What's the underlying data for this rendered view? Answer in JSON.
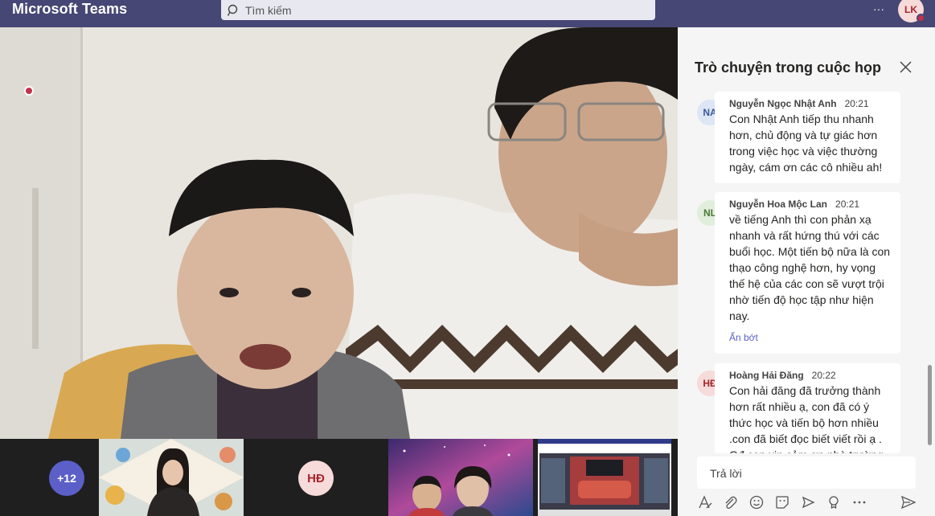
{
  "app": {
    "title": "Microsoft Teams",
    "search_placeholder": "Tìm kiếm",
    "user_initials": "LK",
    "more_label": "···"
  },
  "strip": {
    "overflow_count": "+12",
    "tile_hd_initials": "HĐ"
  },
  "chat": {
    "title": "Trò chuyện trong cuộc họp",
    "messages": [
      {
        "initials": "NA",
        "name": "Nguyễn Ngọc Nhật Anh",
        "time": "20:21",
        "text": "Con Nhật Anh tiếp thu nhanh hơn, chủ động và tự giác hơn trong việc học và việc thường ngày, cám ơn các cô nhiều ah!",
        "status": "busy"
      },
      {
        "initials": "NL",
        "name": "Nguyễn Hoa Mộc Lan",
        "time": "20:21",
        "text": "về tiếng Anh thì con phản xạ nhanh và rất hứng thú với các buổi học. Một tiến bộ nữa là con thạo công nghệ hơn, hy vọng thế hệ của các con sẽ vượt trội nhờ tiến độ học tập như hiện nay.",
        "collapse_label": "Ẩn bớt",
        "status": "busy"
      },
      {
        "initials": "HĐ",
        "name": "Hoàng Hải Đăng",
        "time": "20:22",
        "text": "Con hải đăng đã trưởng thành hơn rất nhiều ạ, con đã có ý thức học và tiến bộ hơn nhiều .con đã biết đọc biết viết rồi ạ . Gđ con xin cảm ơn nhà trường",
        "status": "available"
      }
    ],
    "reply_placeholder": "Trả lời"
  },
  "colors": {
    "topbar": "#464775",
    "accent": "#5b5fc7",
    "busy": "#c4314b",
    "available": "#92c353"
  }
}
